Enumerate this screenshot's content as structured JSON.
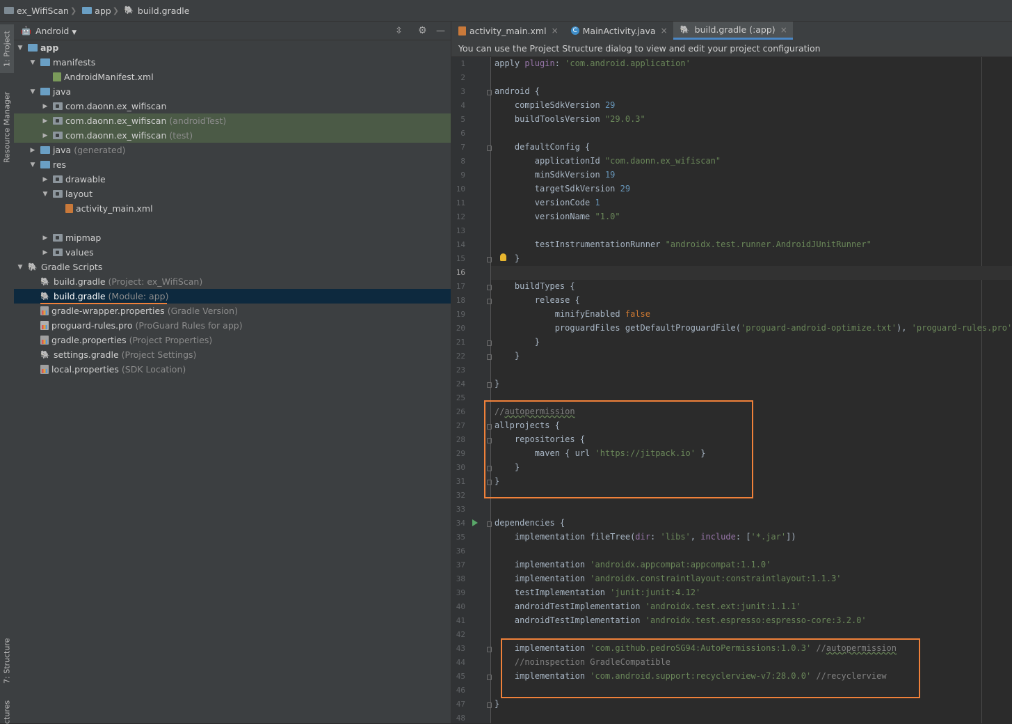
{
  "breadcrumb": {
    "project": "ex_WifiScan",
    "module": "app",
    "file": "build.gradle"
  },
  "left_stripe": {
    "project_tab": "1: Project",
    "resource_manager_tab": "Resource Manager",
    "structure_tab": "7: Structure",
    "captures_tab": "ctures"
  },
  "project_panel": {
    "view_selector": "Android",
    "tree": [
      {
        "label": "app",
        "sub": ""
      },
      {
        "label": "manifests",
        "sub": ""
      },
      {
        "label": "AndroidManifest.xml",
        "sub": ""
      },
      {
        "label": "java",
        "sub": ""
      },
      {
        "label": "com.daonn.ex_wifiscan",
        "sub": ""
      },
      {
        "label": "com.daonn.ex_wifiscan",
        "sub": "(androidTest)"
      },
      {
        "label": "com.daonn.ex_wifiscan",
        "sub": "(test)"
      },
      {
        "label": "java",
        "sub": "(generated)"
      },
      {
        "label": "res",
        "sub": ""
      },
      {
        "label": "drawable",
        "sub": ""
      },
      {
        "label": "layout",
        "sub": ""
      },
      {
        "label": "activity_main.xml",
        "sub": ""
      },
      {
        "label": "mipmap",
        "sub": ""
      },
      {
        "label": "values",
        "sub": ""
      },
      {
        "label": "Gradle Scripts",
        "sub": ""
      },
      {
        "label": "build.gradle",
        "sub": "(Project: ex_WifiScan)"
      },
      {
        "label": "build.gradle",
        "sub": "(Module: app)"
      },
      {
        "label": "gradle-wrapper.properties",
        "sub": "(Gradle Version)"
      },
      {
        "label": "proguard-rules.pro",
        "sub": "(ProGuard Rules for app)"
      },
      {
        "label": "gradle.properties",
        "sub": "(Project Properties)"
      },
      {
        "label": "settings.gradle",
        "sub": "(Project Settings)"
      },
      {
        "label": "local.properties",
        "sub": "(SDK Location)"
      }
    ]
  },
  "editor": {
    "tabs": [
      {
        "label": "activity_main.xml",
        "close": "×"
      },
      {
        "label": "MainActivity.java",
        "close": "×"
      },
      {
        "label": "build.gradle (:app)",
        "close": "×"
      }
    ],
    "notice": "You can use the Project Structure dialog to view and edit your project configuration",
    "line_numbers": [
      "1",
      "2",
      "3",
      "4",
      "5",
      "6",
      "7",
      "8",
      "9",
      "10",
      "11",
      "12",
      "13",
      "14",
      "15",
      "16",
      "17",
      "18",
      "19",
      "20",
      "21",
      "22",
      "23",
      "24",
      "25",
      "26",
      "27",
      "28",
      "29",
      "30",
      "31",
      "32",
      "33",
      "34",
      "35",
      "36",
      "37",
      "38",
      "39",
      "40",
      "41",
      "42",
      "43",
      "44",
      "45",
      "46",
      "47",
      "48"
    ],
    "code_lines": [
      "apply plugin: 'com.android.application'",
      "",
      "android {",
      "    compileSdkVersion 29",
      "    buildToolsVersion \"29.0.3\"",
      "",
      "    defaultConfig {",
      "        applicationId \"com.daonn.ex_wifiscan\"",
      "        minSdkVersion 19",
      "        targetSdkVersion 29",
      "        versionCode 1",
      "        versionName \"1.0\"",
      "",
      "        testInstrumentationRunner \"androidx.test.runner.AndroidJUnitRunner\"",
      "    }",
      "",
      "    buildTypes {",
      "        release {",
      "            minifyEnabled false",
      "            proguardFiles getDefaultProguardFile('proguard-android-optimize.txt'), 'proguard-rules.pro'",
      "        }",
      "    }",
      "",
      "}",
      "",
      "//autopermission",
      "allprojects {",
      "    repositories {",
      "        maven { url 'https://jitpack.io' }",
      "    }",
      "}",
      "",
      "",
      "dependencies {",
      "    implementation fileTree(dir: 'libs', include: ['*.jar'])",
      "",
      "    implementation 'androidx.appcompat:appcompat:1.1.0'",
      "    implementation 'androidx.constraintlayout:constraintlayout:1.1.3'",
      "    testImplementation 'junit:junit:4.12'",
      "    androidTestImplementation 'androidx.test.ext:junit:1.1.1'",
      "    androidTestImplementation 'androidx.test.espresso:espresso-core:3.2.0'",
      "",
      "    implementation 'com.github.pedroSG94:AutoPermissions:1.0.3' //autopermission",
      "    //noinspection GradleCompatible",
      "    implementation 'com.android.support:recyclerview-v7:28.0.0' //recyclerview",
      "",
      "}",
      ""
    ]
  },
  "colors": {
    "highlight_box": "#f0813a",
    "selection": "#0d293e",
    "tab_underline": "#4a88c7"
  }
}
